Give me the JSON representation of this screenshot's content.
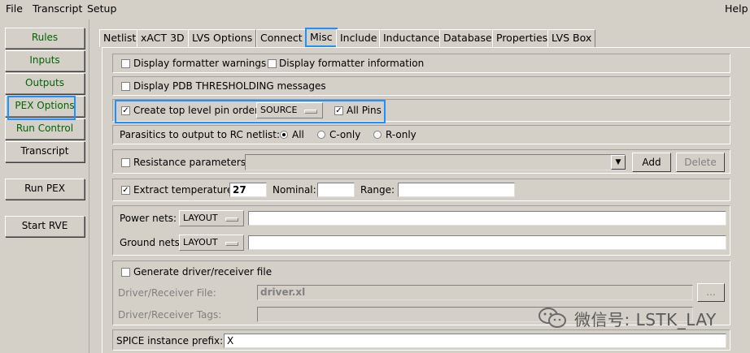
{
  "menubar": {
    "file": "File",
    "transcript": "Transcript",
    "setup": "Setup",
    "help": "Help"
  },
  "sidebar": {
    "rules": "Rules",
    "inputs": "Inputs",
    "outputs": "Outputs",
    "pex_options": "PEX Options",
    "run_control": "Run Control",
    "transcript": "Transcript",
    "run_pex": "Run PEX",
    "start_rve": "Start RVE"
  },
  "tabs": [
    "Netlist",
    "xACT 3D",
    "LVS Options",
    "Connect",
    "Misc",
    "Include",
    "Inductance",
    "Database",
    "Properties",
    "LVS Box"
  ],
  "active_tab": "Misc",
  "misc": {
    "formatter_warnings": "Display formatter warnings",
    "formatter_info": "Display formatter information",
    "pdb_threshold": "Display PDB THRESHOLDING messages",
    "top_pin_order": "Create top level pin order",
    "pin_order_value": "SOURCE",
    "all_pins": "All Pins",
    "parasitics_label": "Parasitics to output to RC netlist:",
    "par_all": "All",
    "par_conly": "C-only",
    "par_ronly": "R-only",
    "resistance_params": "Resistance parameters:",
    "add": "Add",
    "delete": "Delete",
    "extract_temp": "Extract temperature:",
    "temp_value": "27",
    "nominal": "Nominal:",
    "range": "Range:",
    "power_nets": "Power nets:",
    "power_value": "LAYOUT",
    "ground_nets": "Ground nets:",
    "ground_value": "LAYOUT",
    "gen_driver": "Generate driver/receiver file",
    "driver_file_label": "Driver/Receiver File:",
    "driver_file_value": "driver.xl",
    "browse": "...",
    "driver_tags_label": "Driver/Receiver Tags:",
    "spice_prefix": "SPICE instance prefix:",
    "spice_value": "X"
  },
  "watermark": "微信号: LSTK_LAY",
  "colors": {
    "highlight": "#1e90ff",
    "panel": "#d4d0c8",
    "green_text": "#006400"
  }
}
